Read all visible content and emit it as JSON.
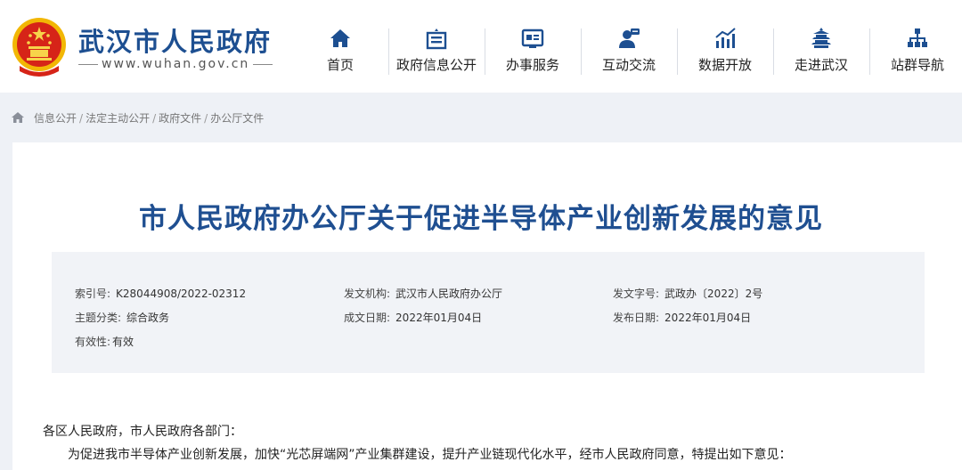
{
  "header": {
    "site_name": "武汉市人民政府",
    "site_url": "www.wuhan.gov.cn"
  },
  "nav": {
    "items": [
      {
        "label": "首页",
        "icon": "home-icon"
      },
      {
        "label": "政府信息公开",
        "icon": "building-icon"
      },
      {
        "label": "办事服务",
        "icon": "id-card-icon"
      },
      {
        "label": "互动交流",
        "icon": "person-chat-icon"
      },
      {
        "label": "数据开放",
        "icon": "bar-chart-icon"
      },
      {
        "label": "走进武汉",
        "icon": "tower-icon"
      },
      {
        "label": "站群导航",
        "icon": "sitemap-icon"
      }
    ]
  },
  "breadcrumb": {
    "items": [
      "信息公开",
      "法定主动公开",
      "政府文件",
      "办公厅文件"
    ],
    "separator": "/"
  },
  "document": {
    "title": "市人民政府办公厅关于促进半导体产业创新发展的意见",
    "meta": {
      "index_label": "索引号:",
      "index_value": "K28044908/2022-02312",
      "issuer_label": "发文机构:",
      "issuer_value": "武汉市人民政府办公厅",
      "docno_label": "发文字号:",
      "docno_value": "武政办〔2022〕2号",
      "topic_label": "主题分类:",
      "topic_value": "综合政务",
      "created_label": "成文日期:",
      "created_value": "2022年01月04日",
      "published_label": "发布日期:",
      "published_value": "2022年01月04日",
      "validity_label": "有效性:",
      "validity_value": "有效"
    },
    "salutation": "各区人民政府，市人民政府各部门：",
    "paragraph1": "为促进我市半导体产业创新发展，加快“光芯屏端网”产业集群建设，提升产业链现代化水平，经市人民政府同意，特提出如下意见："
  },
  "colors": {
    "brand_blue": "#1d4f91",
    "page_bg": "#eef1f6",
    "meta_bg": "#f1f3f7"
  }
}
